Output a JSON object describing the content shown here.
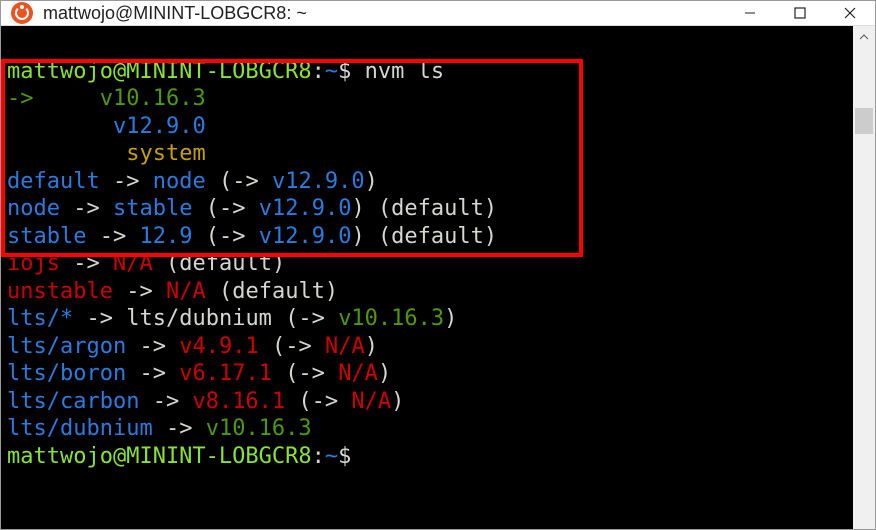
{
  "titlebar": {
    "title": "mattwojo@MININT-LOBGCR8: ~"
  },
  "prompt": {
    "user_host": "mattwojo@MININT-LOBGCR8",
    "sep": ":",
    "path": "~",
    "dollar": "$"
  },
  "command": "nvm ls",
  "output": {
    "cur_arrow": "->",
    "v1": "v10.16.3",
    "v2": "v12.9.0",
    "sys": "system",
    "default_l": "default",
    "arrow": "->",
    "node": "node",
    "paren_open": "(",
    "paren_close": ")",
    "paren_arrow": "(->",
    "v12_9_0": "v12.9.0",
    "node_l": "node",
    "stable": "stable",
    "default_txt": "(default)",
    "stable_l": "stable",
    "n12_9": "12.9",
    "iojs_l": "iojs",
    "na": "N/A",
    "unstable_l": "unstable",
    "lts_star": "lts/*",
    "lts_dubnium": "lts/dubnium",
    "v10_16_3": "v10.16.3",
    "lts_argon": "lts/argon",
    "v4_9_1": "v4.9.1",
    "lts_boron": "lts/boron",
    "v6_17_1": "v6.17.1",
    "lts_carbon": "lts/carbon",
    "v8_16_1": "v8.16.1"
  }
}
